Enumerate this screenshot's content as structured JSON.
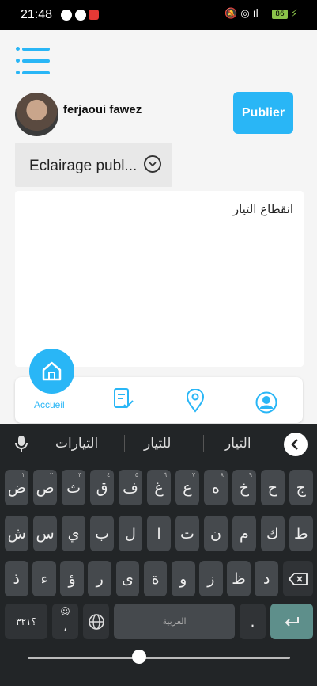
{
  "status": {
    "time": "21:48",
    "battery": "86"
  },
  "header": {
    "username": "ferjaoui fawez",
    "publish_label": "Publier"
  },
  "dropdown": {
    "selected": "Eclairage publ..."
  },
  "post": {
    "text": "انقطاع التيار"
  },
  "bottom_nav": {
    "home_label": "Accueil"
  },
  "keyboard": {
    "suggestions": [
      "التيار",
      "للتيار",
      "التيارات"
    ],
    "rows": [
      [
        [
          "ج",
          ""
        ],
        [
          "ح",
          ""
        ],
        [
          "خ",
          "٩"
        ],
        [
          "ه",
          "٨"
        ],
        [
          "ع",
          "٧"
        ],
        [
          "غ",
          "٦"
        ],
        [
          "ف",
          "٥"
        ],
        [
          "ق",
          "٤"
        ],
        [
          "ث",
          "٣"
        ],
        [
          "ص",
          "٢"
        ],
        [
          "ض",
          "١"
        ]
      ],
      [
        [
          "ط",
          ""
        ],
        [
          "ك",
          ""
        ],
        [
          "م",
          ""
        ],
        [
          "ن",
          ""
        ],
        [
          "ت",
          ""
        ],
        [
          "ا",
          ""
        ],
        [
          "ل",
          ""
        ],
        [
          "ب",
          ""
        ],
        [
          "ي",
          ""
        ],
        [
          "س",
          ""
        ],
        [
          "ش",
          ""
        ]
      ],
      [
        [
          "د",
          ""
        ],
        [
          "ظ",
          ""
        ],
        [
          "ز",
          ""
        ],
        [
          "و",
          ""
        ],
        [
          "ة",
          ""
        ],
        [
          "ى",
          ""
        ],
        [
          "ر",
          ""
        ],
        [
          "ؤ",
          ""
        ],
        [
          "ء",
          ""
        ],
        [
          "ذ",
          ""
        ]
      ]
    ],
    "numbers_label": "؟٣٢١",
    "space_label": "العربية",
    "comma_label": "،",
    "period_label": "."
  },
  "colors": {
    "accent": "#29b6f6"
  }
}
